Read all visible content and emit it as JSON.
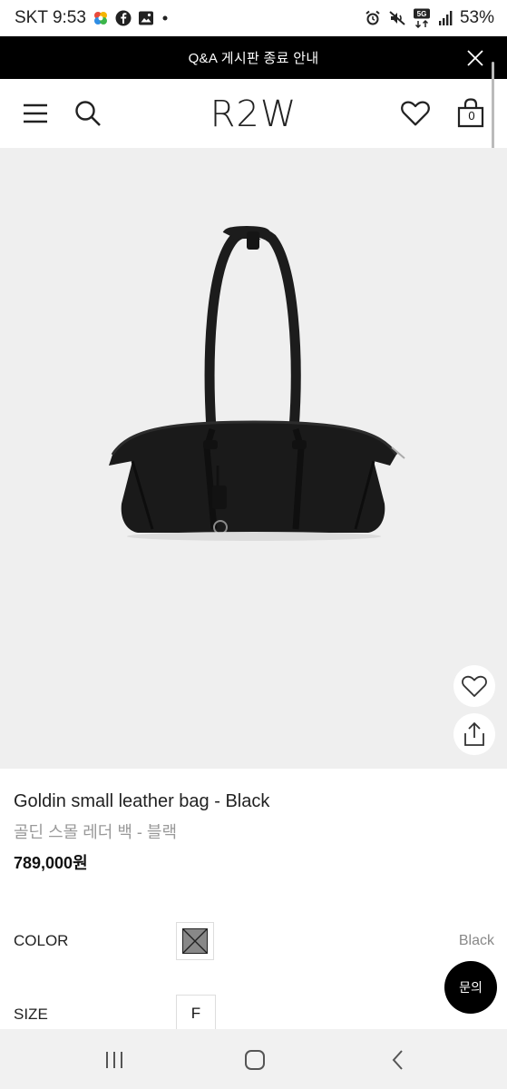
{
  "status_bar": {
    "carrier": "SKT",
    "time": "9:53",
    "network": "5G",
    "battery": "53%",
    "left_icons": [
      "pinwheel-icon",
      "facebook-icon",
      "gallery-icon",
      "dot-icon"
    ],
    "right_icons": [
      "alarm-icon",
      "mute-icon",
      "network-5g-icon",
      "signal-icon"
    ]
  },
  "notice": {
    "text": "Q&A 게시판 종료 안내",
    "close_icon": "close-icon"
  },
  "header": {
    "logo": "R2W",
    "cart_count": "0",
    "icons": [
      "menu-icon",
      "search-icon",
      "heart-icon",
      "shopping-bag-icon"
    ]
  },
  "product": {
    "image_alt": "black leather shoulder bag",
    "name_en": "Goldin small leather bag - Black",
    "name_ko": "골딘 스몰 레더 백 - 블랙",
    "price": "789,000원"
  },
  "options": {
    "color_label": "COLOR",
    "color_value": "Black",
    "size_label": "SIZE",
    "size_value": "F"
  },
  "inquiry_button": "문의",
  "colors": {
    "notice_bg": "#000000",
    "image_bg": "#efefef",
    "swatch": "#888888",
    "nav_bg": "#f1f1f1"
  }
}
